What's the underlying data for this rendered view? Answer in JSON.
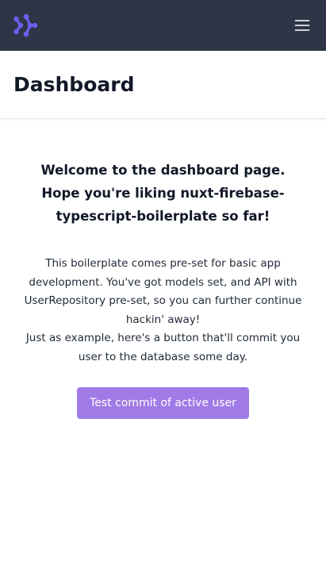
{
  "navbar": {
    "logo_icon": "nuxt-logo-icon",
    "menu_icon": "hamburger-menu-icon",
    "accent_color": "#6f5ef0",
    "background": "#2e3546"
  },
  "header": {
    "title": "Dashboard"
  },
  "main": {
    "welcome_line1": "Welcome to the dashboard page.",
    "welcome_line2": "Hope you're liking nuxt-firebase-typescript-boilerplate so far!",
    "intro_paragraph1": "This boilerplate comes pre-set for basic app development. You've got models set, and API with UserRepository pre-set, so you can further continue hackin' away!",
    "intro_paragraph2": "Just as example, here's a button that'll commit you user to the database some day.",
    "button_label": "Test commit of active user",
    "button_color": "#a07ae6"
  }
}
